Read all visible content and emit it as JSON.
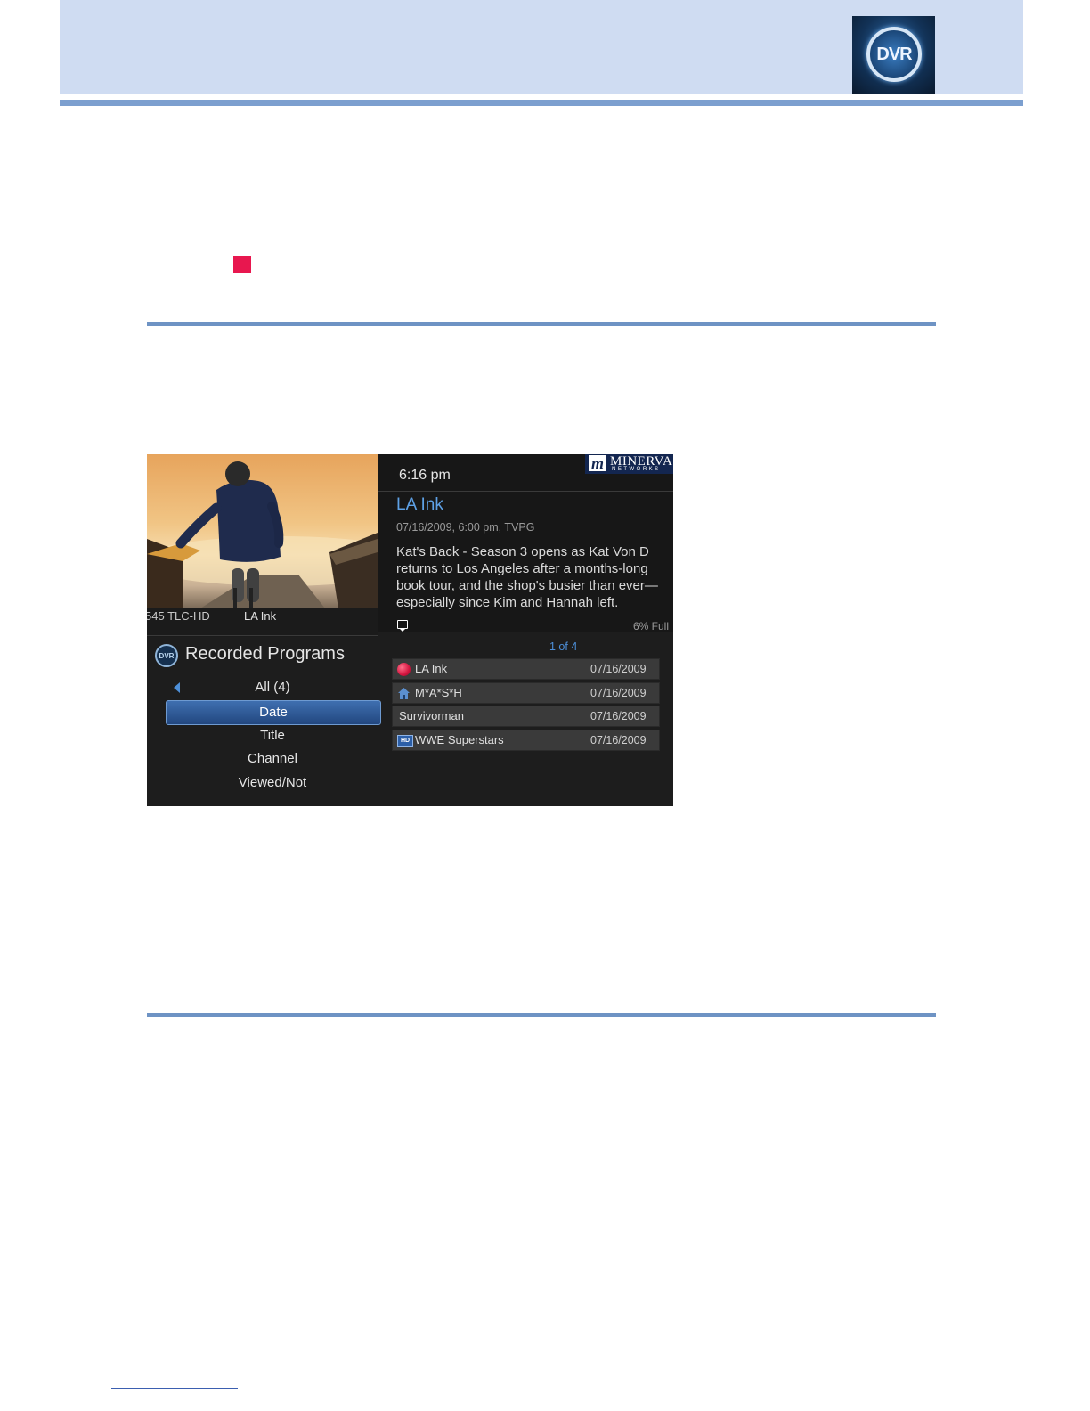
{
  "header": {
    "logo_text": "DVR"
  },
  "tv_screen": {
    "caption": {
      "channel": "545  TLC-HD",
      "program": "LA Ink"
    },
    "clock": "6:16 pm",
    "brand": {
      "mark": "m",
      "name": "MINERVA",
      "sub": "NETWORKS"
    },
    "program": {
      "title": "LA Ink",
      "meta": "07/16/2009,  6:00 pm, TVPG",
      "description": "Kat's Back - Season 3 opens as Kat Von D returns to Los Angeles after a months-long book tour, and the shop's busier than ever—especially since Kim and Hannah left."
    },
    "disk_usage": "6% Full",
    "page_indicator": "1 of 4",
    "menu": {
      "icon_text": "DVR",
      "title": "Recorded Programs",
      "items": [
        "All (4)",
        "Date",
        "Title",
        "Channel",
        "Viewed/Not"
      ],
      "selected": "Date"
    },
    "recordings": [
      {
        "title": "LA Ink",
        "date": "07/16/2009",
        "icon": "recording-dot-icon"
      },
      {
        "title": "M*A*S*H",
        "date": "07/16/2009",
        "icon": "house-icon"
      },
      {
        "title": "Survivorman",
        "date": "07/16/2009",
        "icon": ""
      },
      {
        "title": "WWE Superstars",
        "date": "07/16/2009",
        "icon": "hd-badge-icon",
        "icon_text": "HD"
      }
    ]
  },
  "colors": {
    "header_band": "#cfdcf2",
    "rule": "#6e93c4",
    "accent_blue": "#4d8fd8",
    "bullet_red": "#e8174f",
    "screen_bg": "#1d1d1d"
  }
}
